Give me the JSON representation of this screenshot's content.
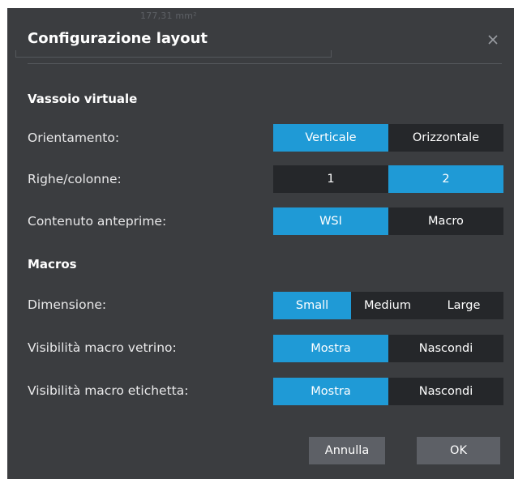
{
  "background_hint": {
    "measurement_text": "177,31 mm²"
  },
  "dialog": {
    "title": "Configurazione layout",
    "close_glyph": "×"
  },
  "sections": {
    "virtual_tray": "Vassoio virtuale",
    "macros": "Macros"
  },
  "rows": {
    "orientation": {
      "label": "Orientamento:",
      "options": [
        "Verticale",
        "Orizzontale"
      ],
      "selected": "Verticale"
    },
    "rows_cols": {
      "label": "Righe/colonne:",
      "options": [
        "1",
        "2"
      ],
      "selected": "2"
    },
    "preview_content": {
      "label": "Contenuto anteprime:",
      "options": [
        "WSI",
        "Macro"
      ],
      "selected": "WSI"
    },
    "dimension": {
      "label": "Dimensione:",
      "options": [
        "Small",
        "Medium",
        "Large"
      ],
      "selected": "Small"
    },
    "slide_macro_visibility": {
      "label": "Visibilità macro vetrino:",
      "options": [
        "Mostra",
        "Nascondi"
      ],
      "selected": "Mostra"
    },
    "label_macro_visibility": {
      "label": "Visibilità macro etichetta:",
      "options": [
        "Mostra",
        "Nascondi"
      ],
      "selected": "Mostra"
    }
  },
  "footer": {
    "cancel_label": "Annulla",
    "ok_label": "OK"
  },
  "colors": {
    "dialog_bg": "#3b3d40",
    "segment_bg": "#25272a",
    "accent": "#1f9ad6",
    "button_bg": "#5d6066"
  },
  "icons": {
    "close": "close-icon"
  }
}
